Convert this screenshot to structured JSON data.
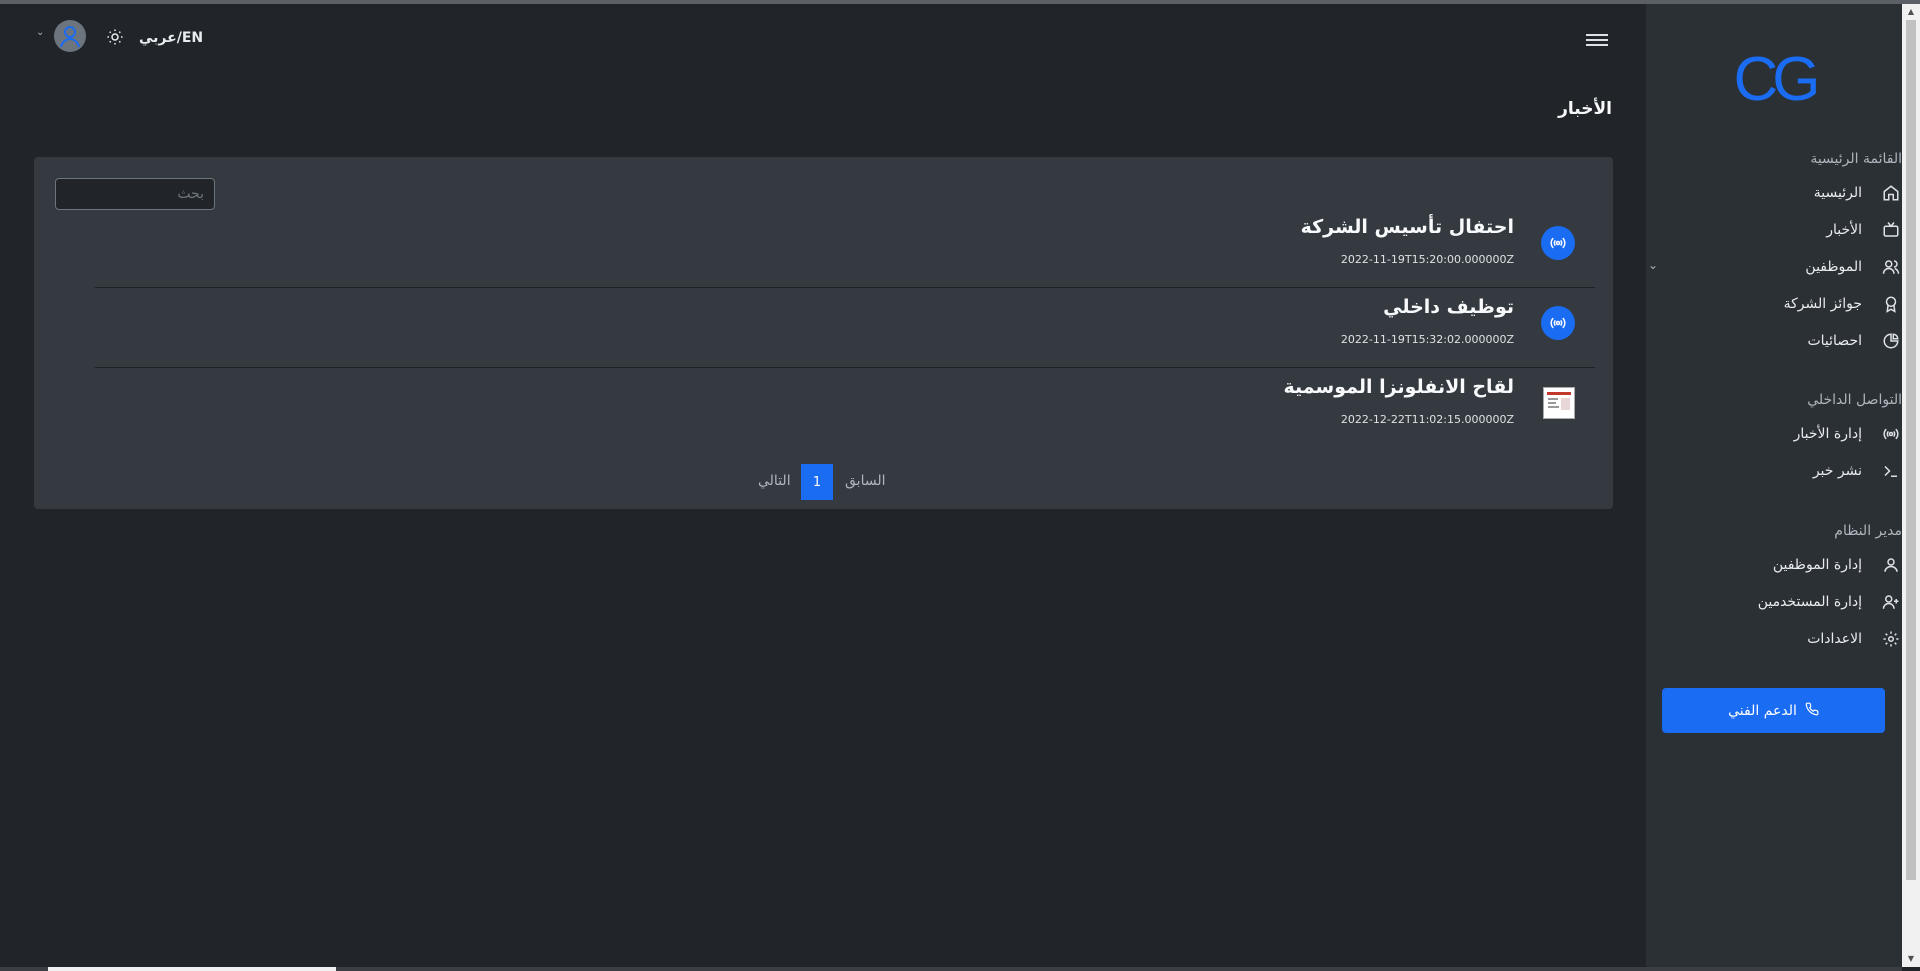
{
  "header": {
    "language_toggle": "عربي/EN"
  },
  "sidebar": {
    "logo": "CG",
    "sections": [
      {
        "title": "القائمة الرئيسية"
      },
      {
        "title": "التواصل الداخلي"
      },
      {
        "title": "مدير النظام"
      }
    ],
    "items": [
      {
        "label": "الرئيسية",
        "icon": "home-icon"
      },
      {
        "label": "الأخبار",
        "icon": "tv-icon"
      },
      {
        "label": "الموظفين",
        "icon": "users-icon"
      },
      {
        "label": "جوائز الشركة",
        "icon": "award-icon"
      },
      {
        "label": "احصائيات",
        "icon": "pie-chart-icon"
      },
      {
        "label": "إدارة الأخبار",
        "icon": "broadcast-icon"
      },
      {
        "label": "نشر خبر",
        "icon": "terminal-icon"
      },
      {
        "label": "إدارة الموظفين",
        "icon": "user-icon"
      },
      {
        "label": "إدارة المستخدمين",
        "icon": "user-plus-icon"
      },
      {
        "label": "الاعدادات",
        "icon": "gear-icon"
      }
    ],
    "support_label": "الدعم الفني"
  },
  "main": {
    "title": "الأخبار",
    "search_placeholder": "بحث",
    "news": [
      {
        "title": "احتفال تأسيس الشركة",
        "date": "2022-11-19T15:20:00.000000Z",
        "icon": "broadcast-icon"
      },
      {
        "title": "توظيف داخلي",
        "date": "2022-11-19T15:32:02.000000Z",
        "icon": "broadcast-icon"
      },
      {
        "title": "لقاح الانفلونزا الموسمية",
        "date": "2022-12-22T11:02:15.000000Z",
        "icon": "thumbnail-image"
      }
    ],
    "pagination": {
      "prev": "السابق",
      "current": "1",
      "next": "التالي"
    }
  },
  "colors": {
    "accent": "#1a6cf2",
    "background": "#212529",
    "sidebar": "#2b3035",
    "card": "#343a40"
  }
}
